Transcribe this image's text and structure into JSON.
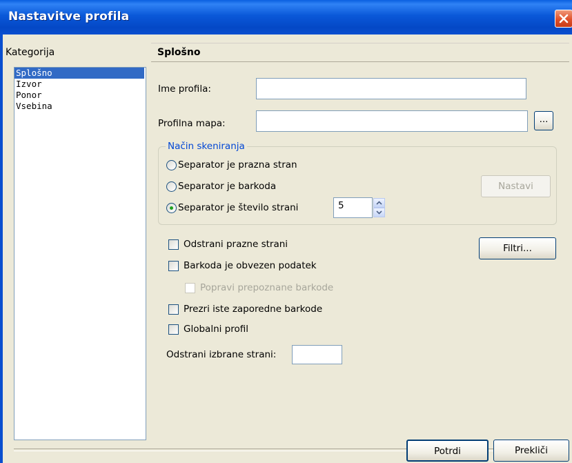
{
  "window": {
    "title": "Nastavitve profila",
    "close_icon": "close-icon"
  },
  "sidebar": {
    "label": "Kategorija",
    "items": [
      {
        "label": "Splošno",
        "selected": true
      },
      {
        "label": "Izvor",
        "selected": false
      },
      {
        "label": "Ponor",
        "selected": false
      },
      {
        "label": "Vsebina",
        "selected": false
      }
    ]
  },
  "panel": {
    "header": "Splošno",
    "profile_name": {
      "label": "Ime profila:",
      "value": ""
    },
    "profile_folder": {
      "label": "Profilna mapa:",
      "value": "",
      "browse_label": "..."
    },
    "scan_mode": {
      "title": "Način skeniranja",
      "options": [
        {
          "label": "Separator je prazna stran",
          "selected": false
        },
        {
          "label": "Separator je barkoda",
          "selected": false
        },
        {
          "label": "Separator je število strani",
          "selected": true
        }
      ],
      "configure_label": "Nastavi",
      "page_count": "5"
    },
    "checkboxes": [
      {
        "label": "Odstrani prazne strani",
        "checked": false,
        "enabled": true
      },
      {
        "label": "Barkoda je obvezen podatek",
        "checked": false,
        "enabled": true
      },
      {
        "label": "Popravi prepoznane barkode",
        "checked": false,
        "enabled": false
      },
      {
        "label": "Prezri iste zaporedne barkode",
        "checked": false,
        "enabled": true
      },
      {
        "label": "Globalni profil",
        "checked": false,
        "enabled": true
      }
    ],
    "filters_label": "Filtri...",
    "remove_pages": {
      "label": "Odstrani izbrane strani:",
      "value": ""
    }
  },
  "footer": {
    "confirm_label": "Potrdi",
    "cancel_label": "Prekliči"
  }
}
